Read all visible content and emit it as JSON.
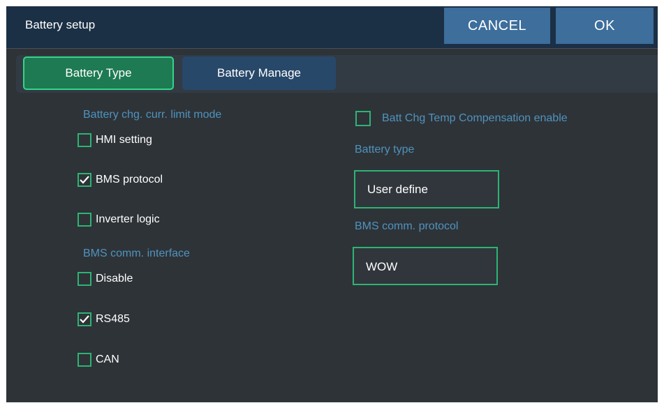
{
  "header": {
    "title": "Battery setup",
    "cancel_label": "CANCEL",
    "ok_label": "OK"
  },
  "tabs": [
    {
      "label": "Battery Type",
      "selected": true
    },
    {
      "label": "Battery Manage",
      "selected": false
    }
  ],
  "left": {
    "chg_limit_mode": {
      "title": "Battery chg. curr. limit mode",
      "options": [
        {
          "label": "HMI setting",
          "checked": false
        },
        {
          "label": "BMS protocol",
          "checked": true
        },
        {
          "label": "Inverter logic",
          "checked": false
        }
      ]
    },
    "bms_interface": {
      "title": "BMS comm. interface",
      "options": [
        {
          "label": "Disable",
          "checked": false
        },
        {
          "label": "RS485",
          "checked": true
        },
        {
          "label": "CAN",
          "checked": false
        }
      ]
    }
  },
  "right": {
    "temp_comp": {
      "label": "Batt Chg Temp Compensation enable",
      "checked": false
    },
    "battery_type": {
      "title": "Battery type",
      "value": "User define"
    },
    "bms_protocol": {
      "title": "BMS comm. protocol",
      "value": "WOW"
    }
  },
  "colors": {
    "accent_green": "#2db474",
    "header_bg": "#1b3045",
    "button_blue": "#3d6e9c",
    "section_title_blue": "#4f93bd",
    "panel_bg": "#2e3338"
  },
  "icons": {
    "checkmark": "checkmark-icon"
  }
}
